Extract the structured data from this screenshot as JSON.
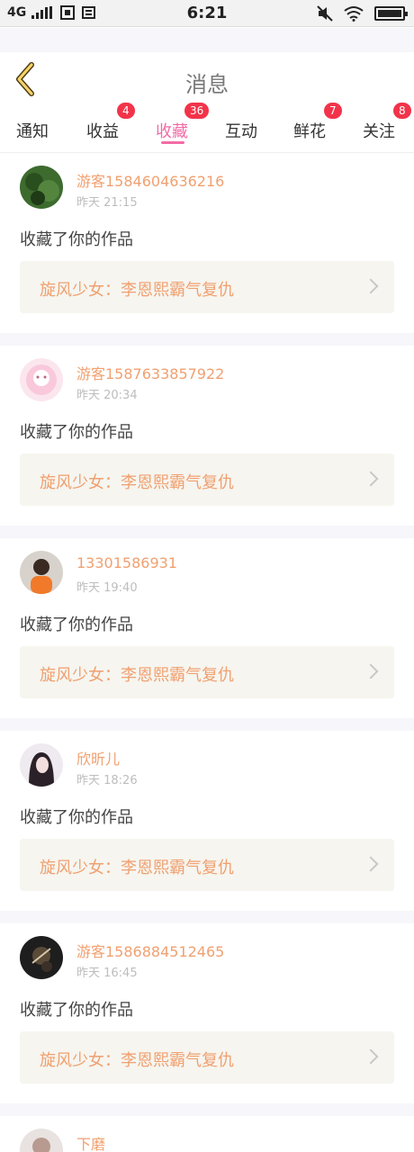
{
  "status_bar": {
    "network": "4G",
    "signal_icon": "signal-bars-icon",
    "time": "6:21"
  },
  "header": {
    "back_icon": "chevron-left-icon",
    "title": "消息"
  },
  "tabs": [
    {
      "label": "通知",
      "badge": ""
    },
    {
      "label": "收益",
      "badge": "4"
    },
    {
      "label": "收藏",
      "badge": "36",
      "active": true
    },
    {
      "label": "互动",
      "badge": ""
    },
    {
      "label": "鲜花",
      "badge": "7"
    },
    {
      "label": "关注",
      "badge": "8"
    }
  ],
  "colors": {
    "accent_pink": "#f26ba6",
    "name_orange": "#f0a070",
    "badge_red": "#f2334a"
  },
  "messages": [
    {
      "user": "游客1584604636216",
      "time": "昨天 21:15",
      "action": "收藏了你的作品",
      "work": "旋风少女：李恩熙霸气复仇"
    },
    {
      "user": "游客1587633857922",
      "time": "昨天 20:34",
      "action": "收藏了你的作品",
      "work": "旋风少女：李恩熙霸气复仇"
    },
    {
      "user": "13301586931",
      "time": "昨天 19:40",
      "action": "收藏了你的作品",
      "work": "旋风少女：李恩熙霸气复仇"
    },
    {
      "user": "欣昕儿",
      "time": "昨天 18:26",
      "action": "收藏了你的作品",
      "work": "旋风少女：李恩熙霸气复仇"
    },
    {
      "user": "游客1586884512465",
      "time": "昨天 16:45",
      "action": "收藏了你的作品",
      "work": "旋风少女：李恩熙霸气复仇"
    },
    {
      "user": "下磨",
      "time": "",
      "action": "",
      "work": ""
    }
  ]
}
